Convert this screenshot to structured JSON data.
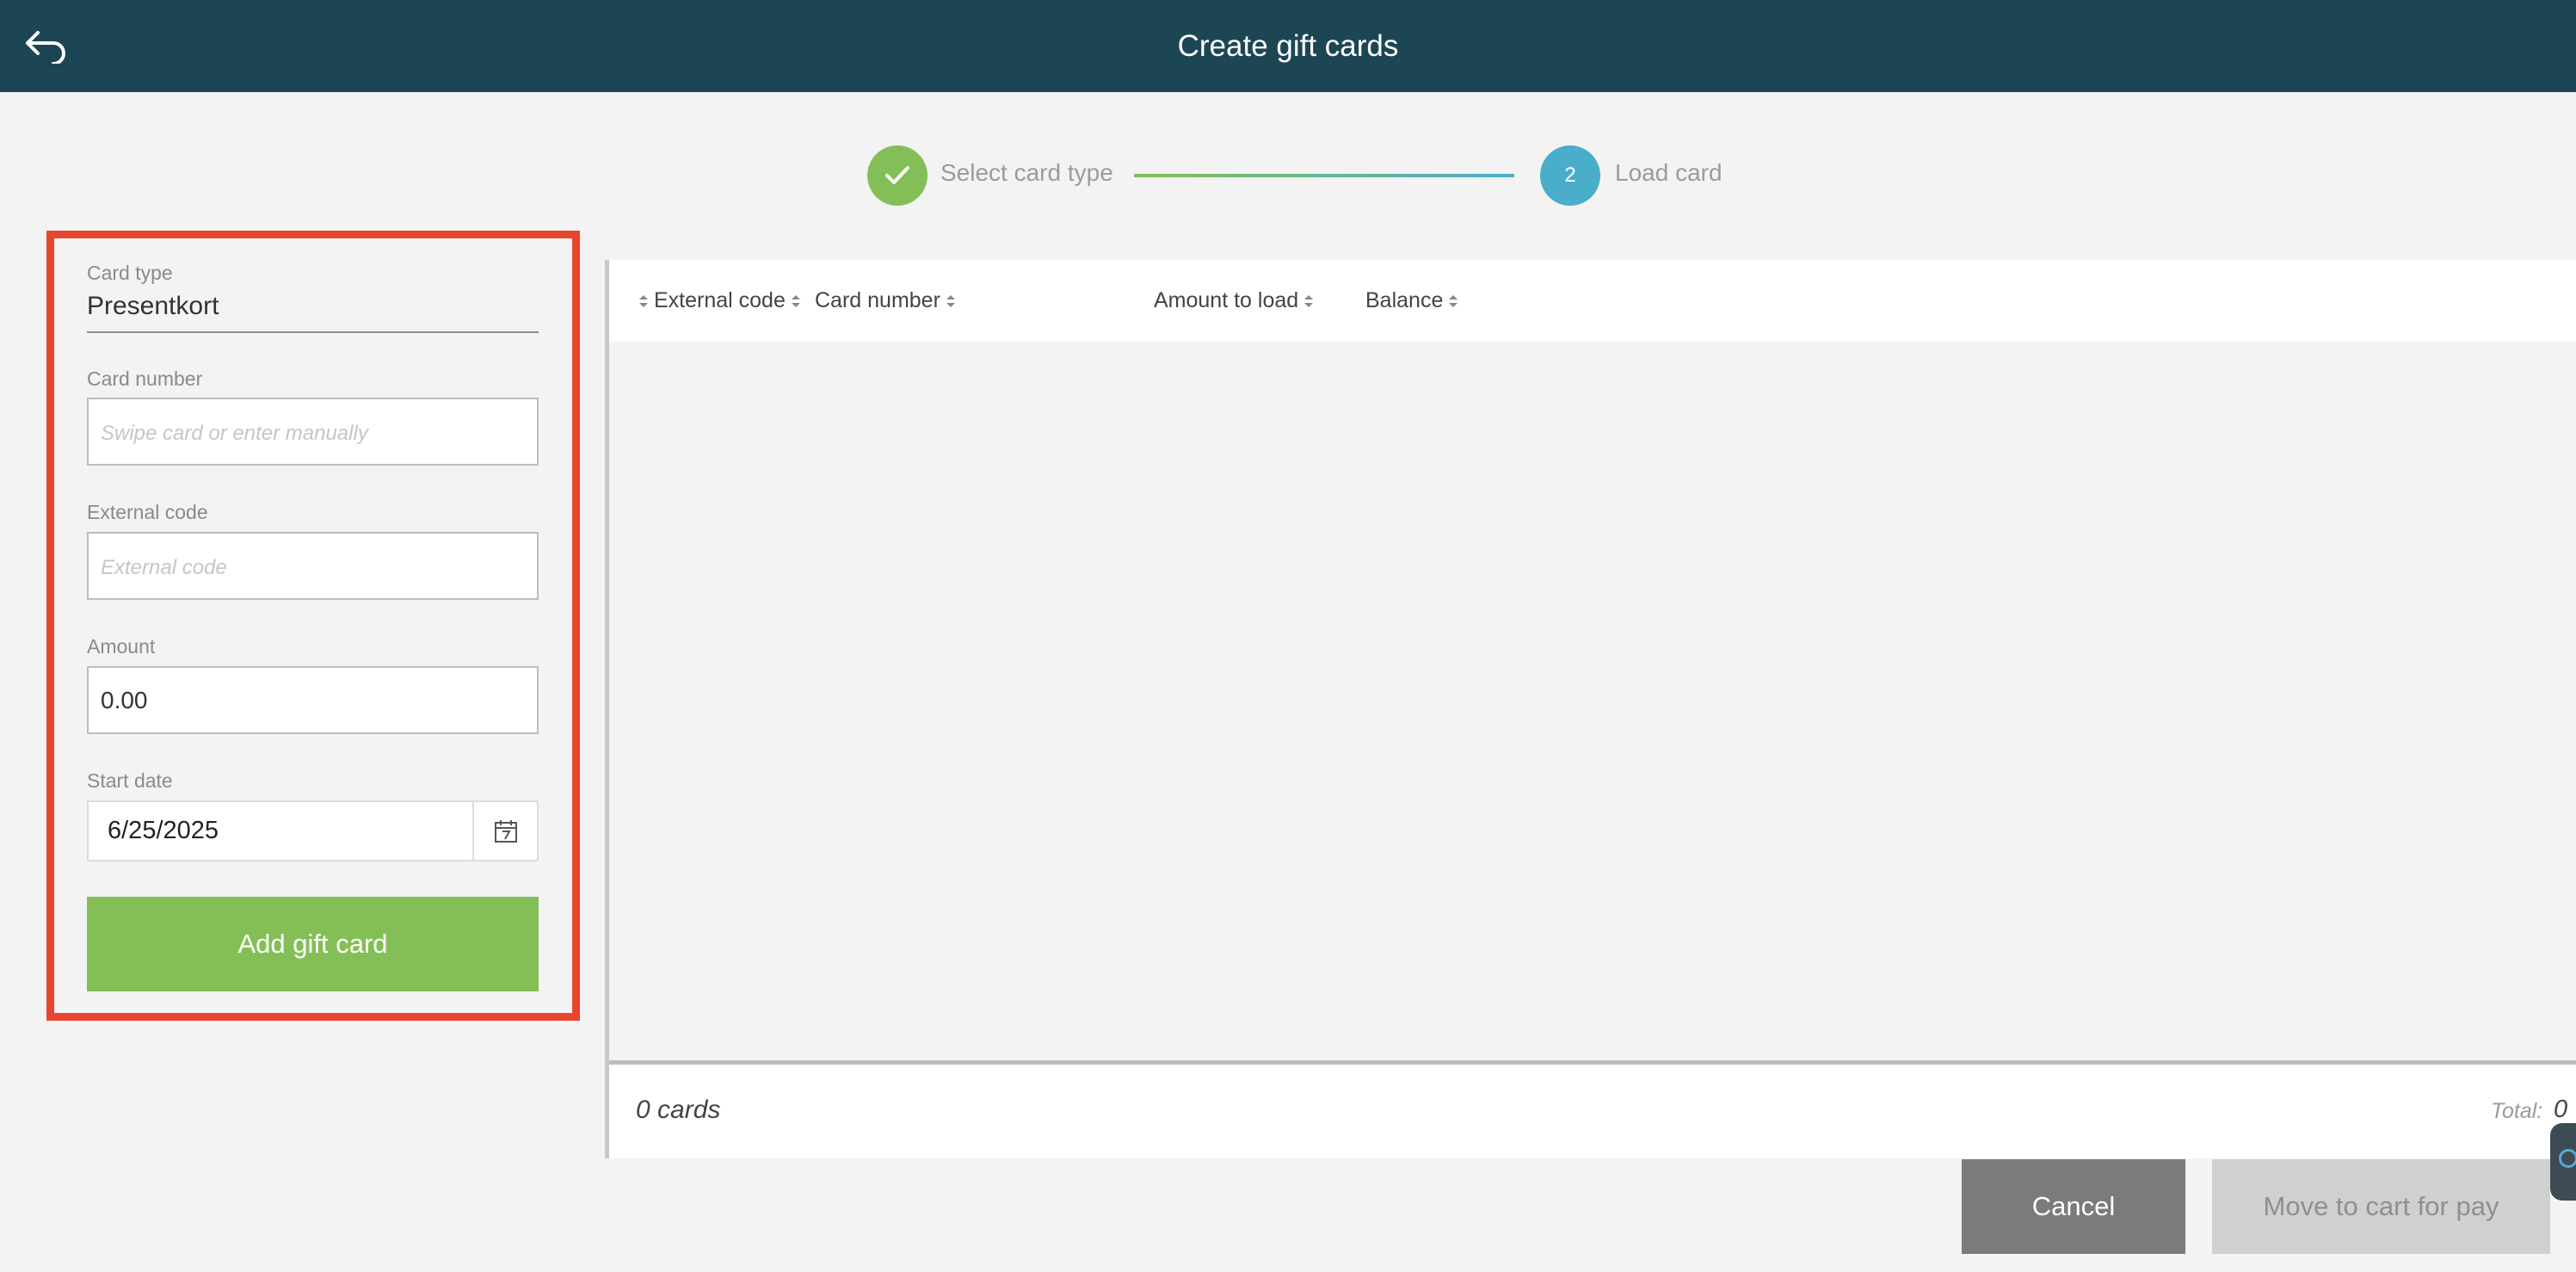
{
  "header": {
    "title": "Create gift cards",
    "back_icon": "back-arrow-icon"
  },
  "stepper": {
    "step1": {
      "label": "Select card type",
      "status": "completed",
      "icon": "check-icon"
    },
    "step2": {
      "label": "Load card",
      "number": "2",
      "status": "active"
    }
  },
  "form": {
    "card_type_label": "Card type",
    "card_type_value": "Presentkort",
    "card_number_label": "Card number",
    "card_number_placeholder": "Swipe card or enter manually",
    "card_number_value": "",
    "external_code_label": "External code",
    "external_code_placeholder": "External code",
    "external_code_value": "",
    "amount_label": "Amount",
    "amount_value": "0.00",
    "start_date_label": "Start date",
    "start_date_value": "6/25/2025",
    "calendar_icon": "calendar-icon",
    "add_button_label": "Add gift card"
  },
  "table": {
    "columns": [
      "External code",
      "Card number",
      "Amount to load",
      "Balance"
    ],
    "rows": [],
    "footer": {
      "count_text": "0 cards",
      "total_label": "Total:",
      "total_value": "0"
    }
  },
  "actions": {
    "cancel_label": "Cancel",
    "move_label": "Move to cart for pay"
  },
  "colors": {
    "header_bg": "#1d4654",
    "accent_green": "#83bf56",
    "accent_blue": "#4aaecb",
    "highlight_border": "#e8452f",
    "cancel_bg": "#7b7b7b",
    "disabled_bg": "#d0d0d0"
  }
}
